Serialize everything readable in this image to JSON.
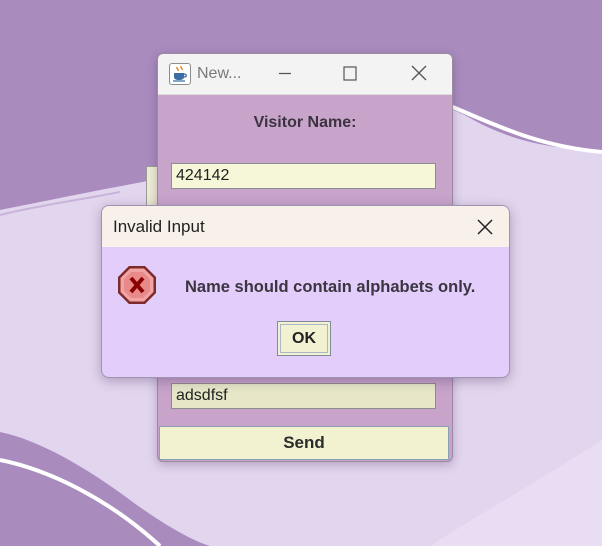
{
  "main_window": {
    "title": "New...",
    "visitor_name_label": "Visitor Name:",
    "visitor_name_value": "424142",
    "second_field_value": "adsdfsf",
    "send_label": "Send",
    "icons": {
      "app": "java-cup-icon",
      "minimize": "minimize-icon",
      "maximize": "maximize-icon",
      "close": "close-icon"
    }
  },
  "dialog": {
    "title": "Invalid Input",
    "message": "Name should contain alphabets only.",
    "ok_label": "OK",
    "icon": "error-icon",
    "close_icon": "close-icon"
  },
  "colors": {
    "desktop_bg": "#e2d6ee",
    "wave_dark": "#a98bbe",
    "main_window_bg": "#c8a4cb",
    "dialog_bg": "#e3cdfb",
    "field_bg": "#f6f6d8",
    "error_red": "#c0392b"
  }
}
